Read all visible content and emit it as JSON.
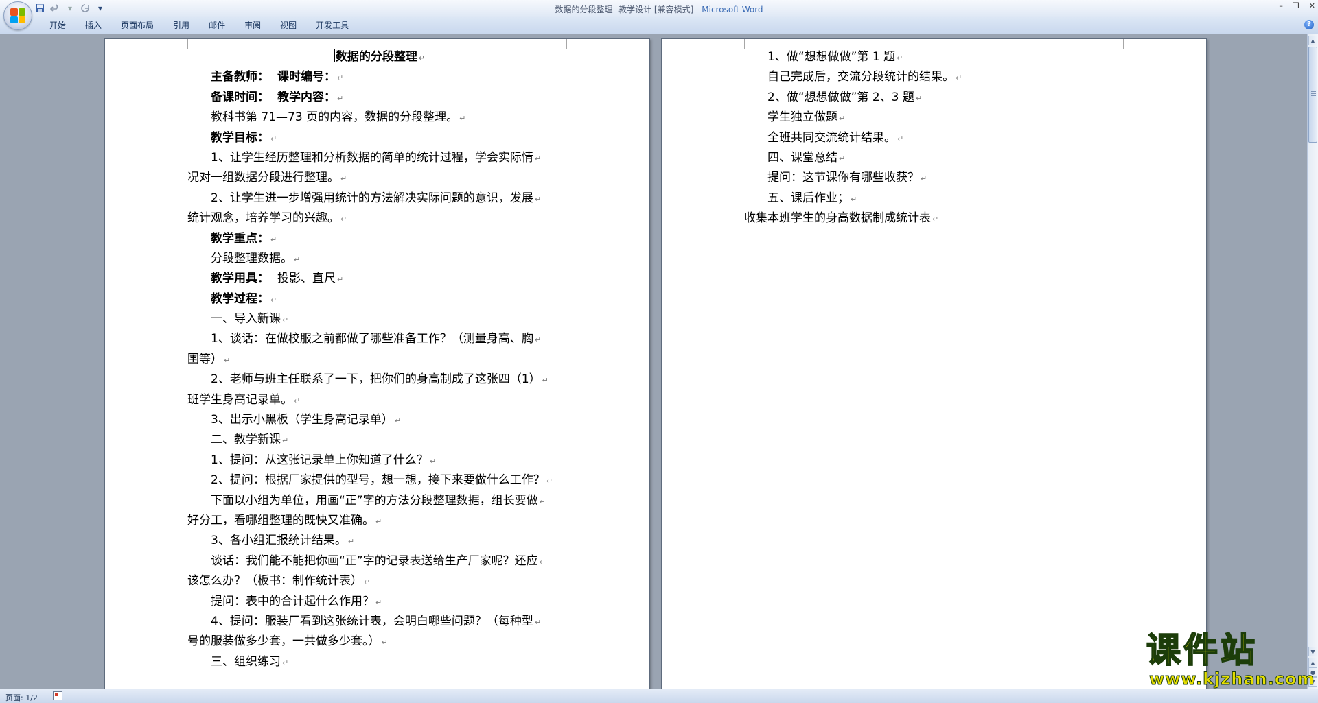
{
  "window": {
    "title": "数据的分段整理--教学设计 [兼容模式]",
    "app_name": "Microsoft Word",
    "title_separator": " - "
  },
  "qat": {
    "save_icon": "save-icon",
    "undo_icon": "undo-icon",
    "redo_icon": "redo-icon",
    "customize_icon": "customize-qat-icon"
  },
  "ribbon": {
    "tabs": [
      "开始",
      "插入",
      "页面布局",
      "引用",
      "邮件",
      "审阅",
      "视图",
      "开发工具"
    ],
    "help_label": "?"
  },
  "page1": {
    "title": "数据的分段整理",
    "lines": [
      {
        "label": "主备教师：",
        "value": "课时编号：",
        "bold": true
      },
      {
        "label": "备课时间：",
        "value": "教学内容：",
        "bold": true
      },
      {
        "text": "教科书第 71—73 页的内容，数据的分段整理。"
      },
      {
        "text": "教学目标：",
        "bold": true
      },
      {
        "text": "1、让学生经历整理和分析数据的简单的统计过程，学会实际情"
      },
      {
        "text": "况对一组数据分段进行整理。",
        "noindent": true
      },
      {
        "text": "2、让学生进一步增强用统计的方法解决实际问题的意识，发展"
      },
      {
        "text": "统计观念，培养学习的兴趣。",
        "noindent": true
      },
      {
        "text": "教学重点：",
        "bold": true
      },
      {
        "text": "分段整理数据。"
      },
      {
        "label": "教学用具：",
        "value": "投影、直尺"
      },
      {
        "text": "教学过程：",
        "bold": true
      },
      {
        "text": "一、导入新课"
      },
      {
        "text": "1、谈话：在做校服之前都做了哪些准备工作？（测量身高、胸"
      },
      {
        "text": "围等）",
        "noindent": true
      },
      {
        "text": "2、老师与班主任联系了一下，把你们的身高制成了这张四（1）"
      },
      {
        "text": "班学生身高记录单。",
        "noindent": true
      },
      {
        "text": "3、出示小黑板（学生身高记录单）"
      },
      {
        "text": "二、教学新课"
      },
      {
        "text": "1、提问：从这张记录单上你知道了什么？"
      },
      {
        "text": "2、提问：根据厂家提供的型号，想一想，接下来要做什么工作？"
      },
      {
        "text": "下面以小组为单位，用画“正”字的方法分段整理数据，组长要做"
      },
      {
        "text": "好分工，看哪组整理的既快又准确。",
        "noindent": true
      },
      {
        "text": "3、各小组汇报统计结果。"
      },
      {
        "text": "谈话：我们能不能把你画“正”字的记录表送给生产厂家呢？还应"
      },
      {
        "text": "该怎么办？（板书：制作统计表）",
        "noindent": true
      },
      {
        "text": "提问：表中的合计起什么作用？"
      },
      {
        "text": "4、提问：服装厂看到这张统计表，会明白哪些问题？（每种型"
      },
      {
        "text": "号的服装做多少套，一共做多少套。）",
        "noindent": true
      },
      {
        "text": "三、组织练习"
      }
    ]
  },
  "page2": {
    "lines": [
      {
        "text": "1、做“想想做做”第 1 题"
      },
      {
        "text": "自己完成后，交流分段统计的结果。"
      },
      {
        "text": "2、做“想想做做”第 2、3 题"
      },
      {
        "text": "学生独立做题"
      },
      {
        "text": "全班共同交流统计结果。"
      },
      {
        "text": "四、课堂总结"
      },
      {
        "text": "提问：这节课你有哪些收获？"
      },
      {
        "text": "五、课后作业；"
      },
      {
        "text": "收集本班学生的身高数据制成统计表",
        "noindent": true
      }
    ]
  },
  "paragraph_mark": "↵",
  "status": {
    "page": "页面: 1/2"
  },
  "watermark": {
    "big": "课件站",
    "url": "www.kjzhan.com"
  }
}
